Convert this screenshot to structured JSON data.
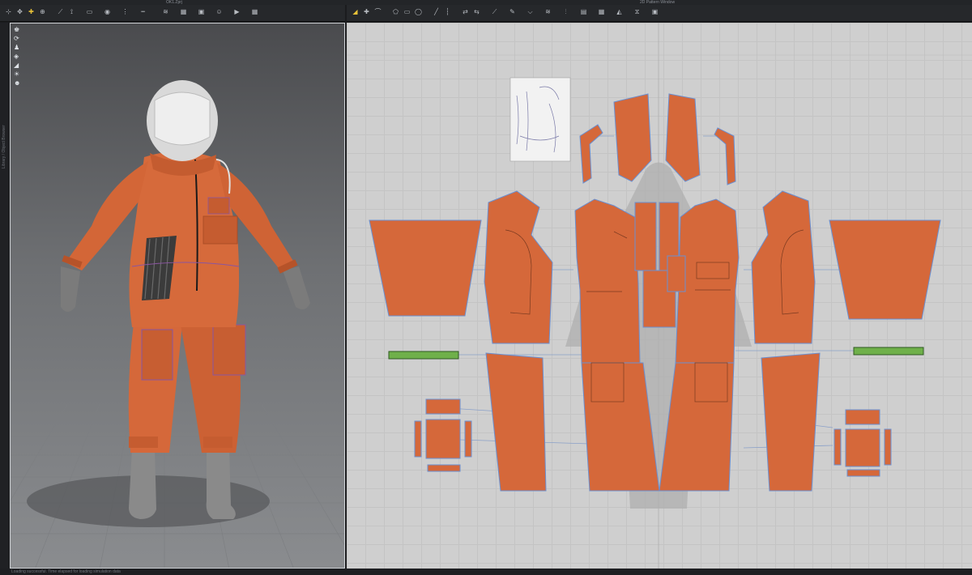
{
  "window": {
    "title_3d": "OK1.Zprj",
    "title_2d": "2D Pattern Window",
    "status_text": "Loading successful. Time elapsed for loading simulation data"
  },
  "toolbar_3d": {
    "icons": [
      "select-icon",
      "move-icon",
      "pin-icon",
      "gizmo-icon",
      "fold-icon",
      "measure-icon",
      "tape-icon",
      "button-icon",
      "zipper-icon",
      "topstitch-icon",
      "puckering-icon",
      "texture-icon",
      "graphic-icon",
      "avatar-icon",
      "simulate-icon",
      "grid-icon"
    ]
  },
  "toolbar_2d": {
    "icons": [
      "transform-pattern-icon",
      "edit-point-icon",
      "curve-icon",
      "polygon-icon",
      "rectangle-icon",
      "circle-icon",
      "internal-line-icon",
      "seam-icon",
      "segment-sewing-icon",
      "free-sewing-icon",
      "fold-arrangement-icon",
      "trace-icon",
      "notch-icon",
      "gather-icon",
      "pleat-icon",
      "layout-icon",
      "grid-icon",
      "dart-icon",
      "symmetry-icon",
      "graphic-icon"
    ]
  },
  "viewport_3d": {
    "side_label": "Library / Object Browser",
    "quick_icons": [
      "garment-icon",
      "simulation-icon",
      "avatar-view-icon",
      "texture-view-icon",
      "fabric-icon",
      "lamp-icon",
      "person-icon"
    ]
  },
  "colors": {
    "fabric": "#d5683a",
    "fabric_dark": "#b0522b",
    "grid": "#c4c4c4",
    "seam_blue": "#6a8fd0",
    "sewing_line": "#8aa0c8",
    "elastic_green": "#6fb04a"
  }
}
